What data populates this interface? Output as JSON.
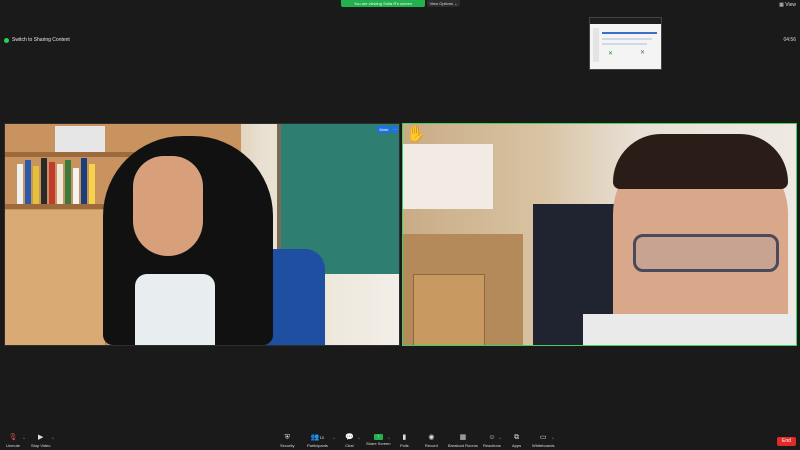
{
  "top": {
    "share_banner": "You are viewing Sofia R's screen",
    "view_options": "View Options ⌄",
    "view": "View",
    "switch_sharing": "Switch to Sharing Content",
    "timer": "04:56"
  },
  "tiles": {
    "left": {
      "mute_badge": "Mute",
      "more": "···"
    },
    "right": {
      "reaction": "✋"
    }
  },
  "toolbar": {
    "unmute": "Unmute",
    "stop_video": "Stop Video",
    "security": "Security",
    "participants": "Participants",
    "participants_count": "10",
    "chat": "Chat",
    "share_screen": "Share Screen",
    "polls": "Polls",
    "record": "Record",
    "breakout_rooms": "Breakout Rooms",
    "reactions": "Reactions",
    "apps": "Apps",
    "whiteboards": "Whiteboards",
    "end": "End"
  },
  "icons": {
    "mic": "mic-muted-icon",
    "video": "video-camera-icon",
    "security": "shield-icon",
    "participants": "people-icon",
    "chat": "chat-bubble-icon",
    "share": "share-screen-icon",
    "polls": "bar-chart-icon",
    "record": "record-icon",
    "breakout": "grid-icon",
    "reactions": "smiley-icon",
    "apps": "apps-icon",
    "whiteboards": "whiteboard-icon"
  },
  "colors": {
    "accent_green": "#23b14d",
    "end_red": "#e02b2b",
    "badge_blue": "#1f6fe6"
  }
}
